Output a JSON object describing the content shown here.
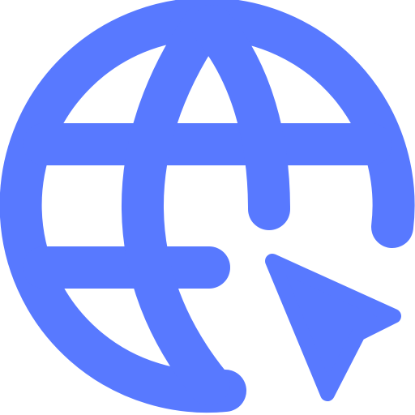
{
  "icon": {
    "name": "globe-with-cursor-icon",
    "color": "#5879FF",
    "background": "#FFFFFF"
  }
}
